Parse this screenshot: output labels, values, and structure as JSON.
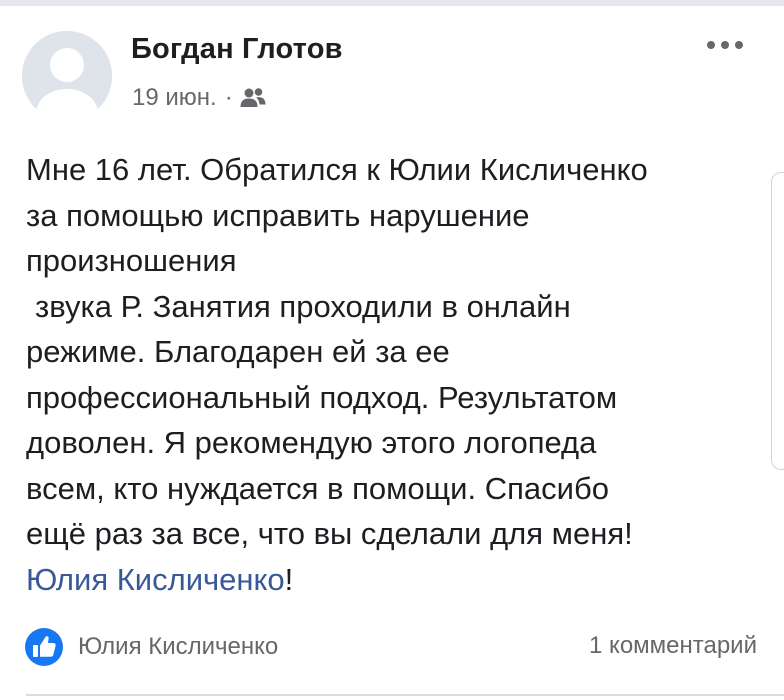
{
  "post": {
    "author_name": "Богдан Глотов",
    "date": "19 июн.",
    "separator": "·",
    "audience_icon": "friends-icon",
    "more_icon": "more-dots-icon",
    "text_lines": [
      "Мне 16 лет. Обратился к Юлии Кисличенко",
      "за помощью исправить нарушение",
      "произношения",
      "звука Р. Занятия проходили в онлайн",
      "режиме. Благодарен ей за ее",
      "профессиональный подход. Результатом",
      "доволен.  Я рекомендую этого логопеда",
      "всем, кто нуждается в помощи. Спасибо",
      "ещё раз за все, что вы сделали для меня!"
    ],
    "mention": "Юлия Кисличенко",
    "mention_suffix": "!"
  },
  "footer": {
    "reaction_icon": "like-icon",
    "reaction_name": "Юлия Кисличенко",
    "comments_count": "1 комментарий"
  },
  "colors": {
    "text": "#1c1e21",
    "secondary_text": "#65676b",
    "link": "#385898",
    "like_blue": "#1877f2"
  }
}
